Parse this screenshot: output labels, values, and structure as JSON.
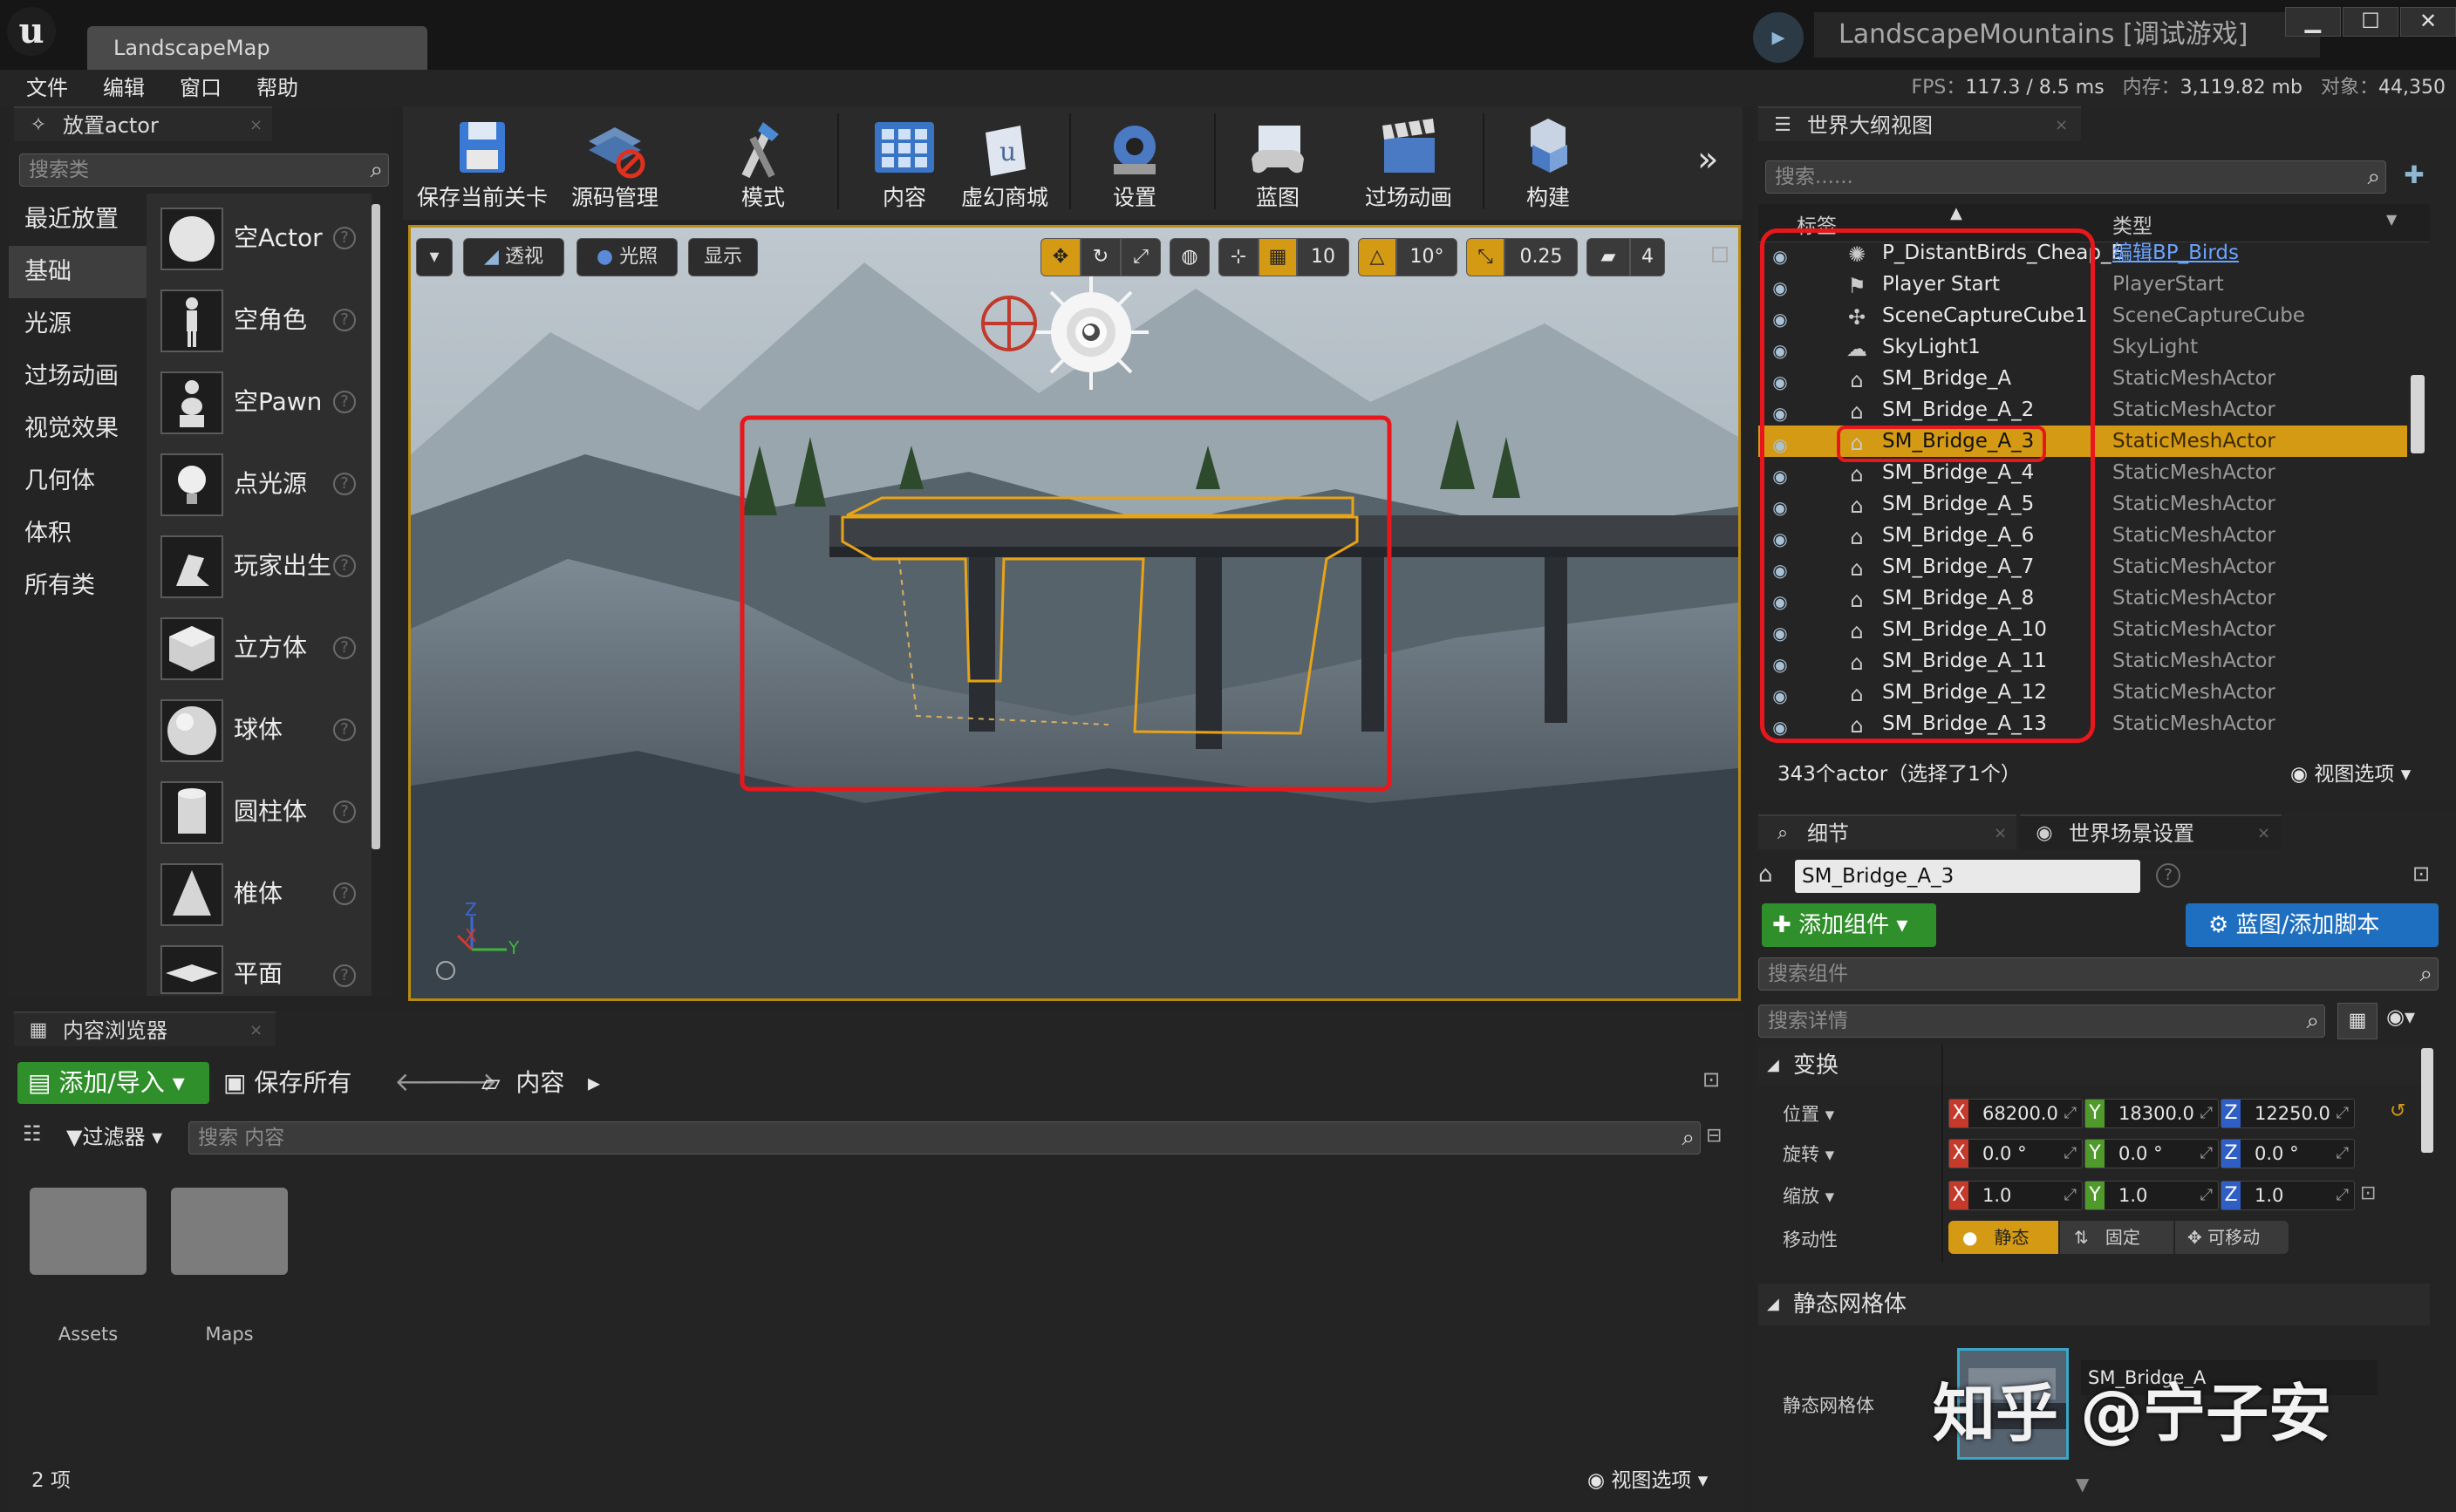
{
  "window": {
    "doc_tab": "LandscapeMap",
    "title": "LandscapeMountains [调试游戏]",
    "min": "▁",
    "max": "☐",
    "close": "✕"
  },
  "menu": [
    "文件",
    "编辑",
    "窗口",
    "帮助"
  ],
  "stats": {
    "fps_label": "FPS：",
    "fps": "117.3",
    "ms": "/ 8.5 ms",
    "mem_label": "内存：",
    "mem": "3,119.82 mb",
    "obj_label": "对象：",
    "obj": "44,350"
  },
  "place": {
    "tab": "放置actor",
    "search_placeholder": "搜索类",
    "categories": [
      "最近放置",
      "基础",
      "光源",
      "过场动画",
      "视觉效果",
      "几何体",
      "体积",
      "所有类"
    ],
    "selected_category": "基础",
    "items": [
      "空Actor",
      "空角色",
      "空Pawn",
      "点光源",
      "玩家出生",
      "立方体",
      "球体",
      "圆柱体",
      "椎体",
      "平面"
    ],
    "help": "?"
  },
  "toolbar": {
    "buttons": [
      "保存当前关卡",
      "源码管理",
      "模式",
      "内容",
      "虚幻商城",
      "设置",
      "蓝图",
      "过场动画",
      "构建"
    ],
    "more": "»"
  },
  "viewport": {
    "perspective": "透视",
    "lit": "光照",
    "show": "显示",
    "grid_snap": "10",
    "rot_snap": "10°",
    "scale_snap": "0.25",
    "cam_speed": "4",
    "axis_z": "Z",
    "axis_x": "X",
    "axis_y": "Y"
  },
  "outliner": {
    "tab": "世界大纲视图",
    "search_placeholder": "搜索......",
    "col_label": "标签",
    "col_type": "类型",
    "rows": [
      {
        "name": "P_DistantBirds_Cheap_E",
        "type": "编辑BP_Birds",
        "link": true
      },
      {
        "name": "Player Start",
        "type": "PlayerStart"
      },
      {
        "name": "SceneCaptureCube1",
        "type": "SceneCaptureCube"
      },
      {
        "name": "SkyLight1",
        "type": "SkyLight"
      },
      {
        "name": "SM_Bridge_A",
        "type": "StaticMeshActor"
      },
      {
        "name": "SM_Bridge_A_2",
        "type": "StaticMeshActor"
      },
      {
        "name": "SM_Bridge_A_3",
        "type": "StaticMeshActor",
        "selected": true
      },
      {
        "name": "SM_Bridge_A_4",
        "type": "StaticMeshActor"
      },
      {
        "name": "SM_Bridge_A_5",
        "type": "StaticMeshActor"
      },
      {
        "name": "SM_Bridge_A_6",
        "type": "StaticMeshActor"
      },
      {
        "name": "SM_Bridge_A_7",
        "type": "StaticMeshActor"
      },
      {
        "name": "SM_Bridge_A_8",
        "type": "StaticMeshActor"
      },
      {
        "name": "SM_Bridge_A_10",
        "type": "StaticMeshActor"
      },
      {
        "name": "SM_Bridge_A_11",
        "type": "StaticMeshActor"
      },
      {
        "name": "SM_Bridge_A_12",
        "type": "StaticMeshActor"
      },
      {
        "name": "SM_Bridge_A_13",
        "type": "StaticMeshActor"
      }
    ],
    "count": "343个actor（选择了1个）",
    "view_options": "视图选项"
  },
  "details": {
    "tab": "细节",
    "tab2": "世界场景设置",
    "name": "SM_Bridge_A_3",
    "add_component": "添加组件",
    "blueprint": "蓝图/添加脚本",
    "search_components": "搜索组件",
    "search_details": "搜索详情",
    "transform": "变换",
    "location_label": "位置",
    "rotation_label": "旋转",
    "scale_label": "缩放",
    "mobility_label": "移动性",
    "location": [
      "68200.0",
      "18300.0",
      "12250.0"
    ],
    "rotation": [
      "0.0 °",
      "0.0 °",
      "0.0 °"
    ],
    "scale": [
      "1.0",
      "1.0",
      "1.0"
    ],
    "mob_static": "静态",
    "mob_stationary": "固定",
    "mob_movable": "可移动",
    "static_mesh_section": "静态网格体",
    "static_mesh_label": "静态网格体",
    "mesh_name": "SM_Bridge_A",
    "watermark": "知乎 @宁子安"
  },
  "content": {
    "tab": "内容浏览器",
    "add_import": "添加/导入",
    "save_all": "保存所有",
    "path": "内容",
    "filters": "过滤器",
    "search_placeholder": "搜索 内容",
    "folders": [
      "Assets",
      "Maps"
    ],
    "count": "2 项",
    "view_options": "视图选项"
  },
  "colors": {
    "accent": "#d59a14",
    "highlight_red": "#e8171c",
    "blue_button": "#1f6fc0",
    "green_button": "#2f8f2a"
  }
}
